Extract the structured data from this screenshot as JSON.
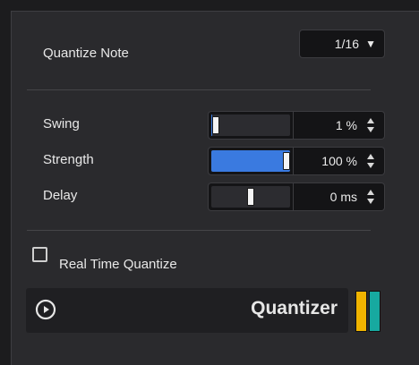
{
  "quantize_note": {
    "label": "Quantize Note",
    "value": "1/16",
    "arrow_icon": "triangle-down-icon"
  },
  "params": [
    {
      "name": "Swing",
      "value": "1 %",
      "level": 0.01
    },
    {
      "name": "Strength",
      "value": "100 %",
      "level": 1.0
    },
    {
      "name": "Delay",
      "value": "0 ms",
      "level": 0.5
    }
  ],
  "realtime": {
    "label": "Real Time Quantize",
    "checked": false
  },
  "quantizer": {
    "title": "Quantizer",
    "play_icon": "play-circle-icon"
  },
  "colors": {
    "accent_fill": "#3a7ae0",
    "yellow": "#f0b400",
    "teal": "#17a9a0"
  }
}
